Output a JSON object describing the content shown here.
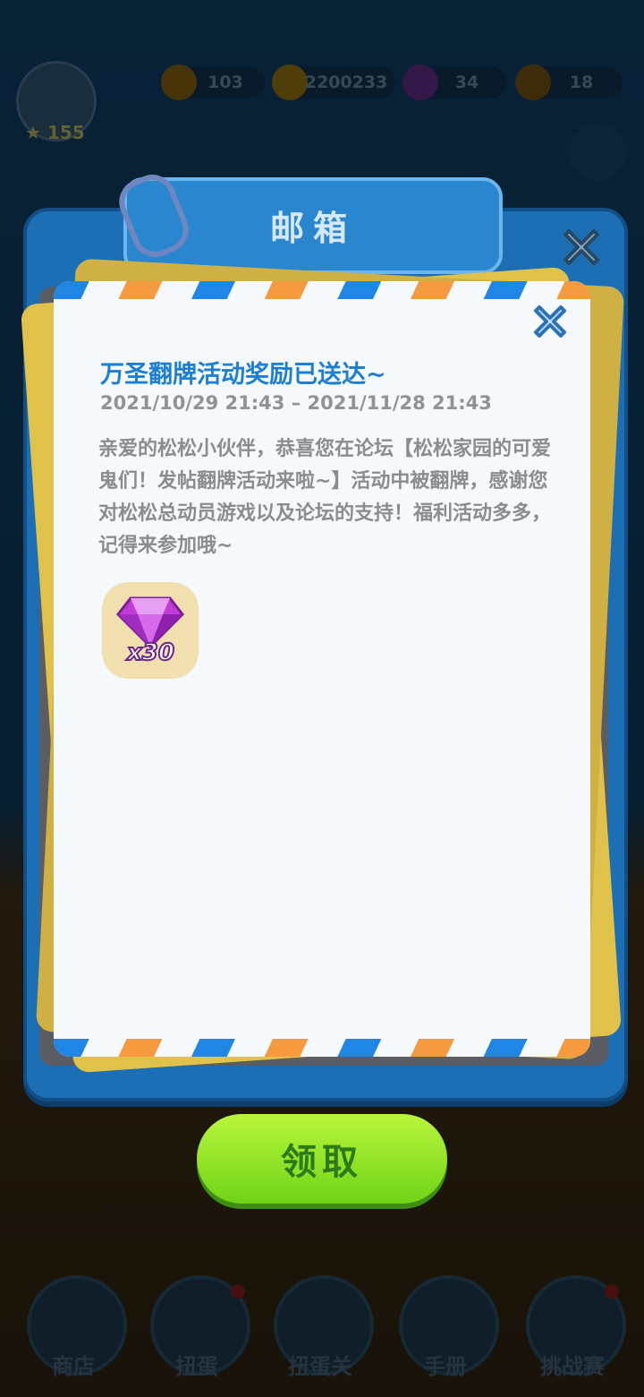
{
  "hud": {
    "level": "155",
    "resources": [
      {
        "name": "energy",
        "value": "103",
        "icon": "lightning-icon",
        "color": "#7c5a10"
      },
      {
        "name": "coins",
        "value": "2200233",
        "icon": "coin-icon",
        "color": "#8a6b10"
      },
      {
        "name": "gems",
        "value": "34",
        "icon": "gem-icon",
        "color": "#5a2a7a"
      },
      {
        "name": "crowns",
        "value": "18",
        "icon": "crown-icon",
        "color": "#6a4c12"
      }
    ]
  },
  "mailbox": {
    "title": "邮箱"
  },
  "mail": {
    "title": "万圣翻牌活动奖励已送达~",
    "date_range": "2021/10/29  21:43 – 2021/11/28  21:43",
    "body": "亲爱的松松小伙伴，恭喜您在论坛【松松家园的可爱鬼们！发帖翻牌活动来啦~】活动中被翻牌，感谢您对松松总动员游戏以及论坛的支持！福利活动多多，记得来参加哦~",
    "reward": {
      "icon": "purple-gem-icon",
      "quantity": "x30"
    }
  },
  "claim_button": {
    "label": "领取"
  },
  "bottom_tabs": [
    {
      "label": "商店",
      "has_dot": false
    },
    {
      "label": "扭蛋",
      "has_dot": true
    },
    {
      "label": "扭蛋关",
      "has_dot": false
    },
    {
      "label": "手册",
      "has_dot": false
    },
    {
      "label": "挑战赛",
      "has_dot": true
    }
  ],
  "colors": {
    "accent_blue": "#1c7fd2",
    "claim_green": "#7ddc1e",
    "stripe_orange": "#f59a3e",
    "stripe_blue": "#1f86e6"
  }
}
